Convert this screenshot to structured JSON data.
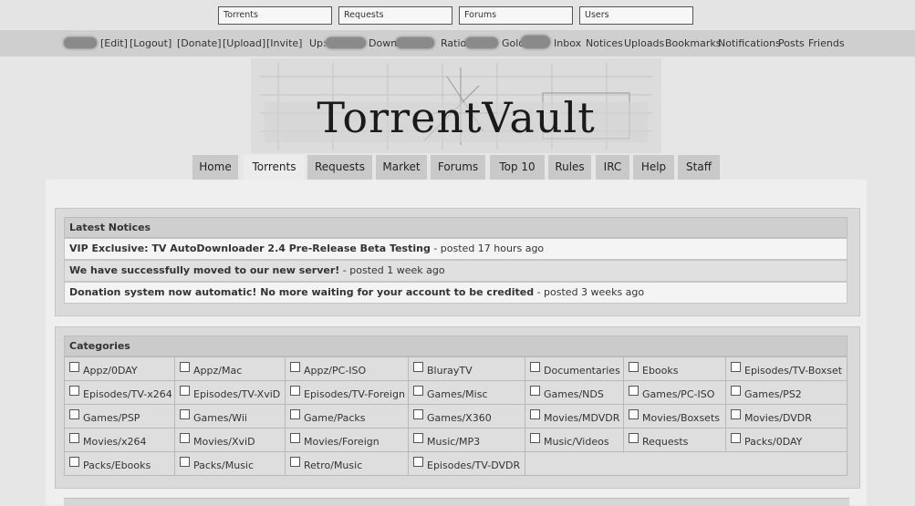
{
  "search_bar": [
    "Torrents",
    "Requests",
    "Forums",
    "Users"
  ],
  "userbar": {
    "edit": "[Edit]",
    "logout": "[Logout]",
    "donate": "[Donate]",
    "upload": "[Upload]",
    "invite": "[Invite]",
    "up": "Up:",
    "down": "Down:",
    "ratio": "Ratio",
    "gold": "Gold",
    "links": [
      "Inbox",
      "Notices",
      "Uploads",
      "Bookmarks",
      "Notifications",
      "Posts",
      "Friends"
    ]
  },
  "logo": {
    "text": "TorrentVault"
  },
  "nav": {
    "tabs": [
      "Home",
      "Torrents",
      "Requests",
      "Market",
      "Forums",
      "Top 10",
      "Rules",
      "IRC",
      "Help",
      "Staff"
    ],
    "active": "Torrents"
  },
  "notices": {
    "title": "Latest Notices",
    "items": [
      {
        "title": "VIP Exclusive: TV AutoDownloader 2.4 Pre-Release Beta Testing",
        "posted": " - posted 17 hours ago"
      },
      {
        "title": "We have successfully moved to our new server!",
        "posted": " - posted 1 week ago"
      },
      {
        "title": "Donation system now automatic! No more waiting for your account to be credited",
        "posted": " - posted 3 weeks ago"
      }
    ]
  },
  "categories": {
    "title": "Categories",
    "items": [
      "Appz/0DAY",
      "Appz/Mac",
      "Appz/PC-ISO",
      "BlurayTV",
      "Documentaries",
      "Ebooks",
      "Episodes/TV-Boxset",
      "Episodes/TV-x264",
      "Episodes/TV-XviD",
      "Episodes/TV-Foreign",
      "Games/Misc",
      "Games/NDS",
      "Games/PC-ISO",
      "Games/PS2",
      "Games/PSP",
      "Games/Wii",
      "Game/Packs",
      "Games/X360",
      "Movies/MDVDR",
      "Movies/Boxsets",
      "Movies/DVDR",
      "Movies/x264",
      "Movies/XviD",
      "Movies/Foreign",
      "Music/MP3",
      "Music/Videos",
      "Requests",
      "Packs/0DAY",
      "Packs/Ebooks",
      "Packs/Music",
      "Retro/Music",
      "Episodes/TV-DVDR"
    ]
  }
}
